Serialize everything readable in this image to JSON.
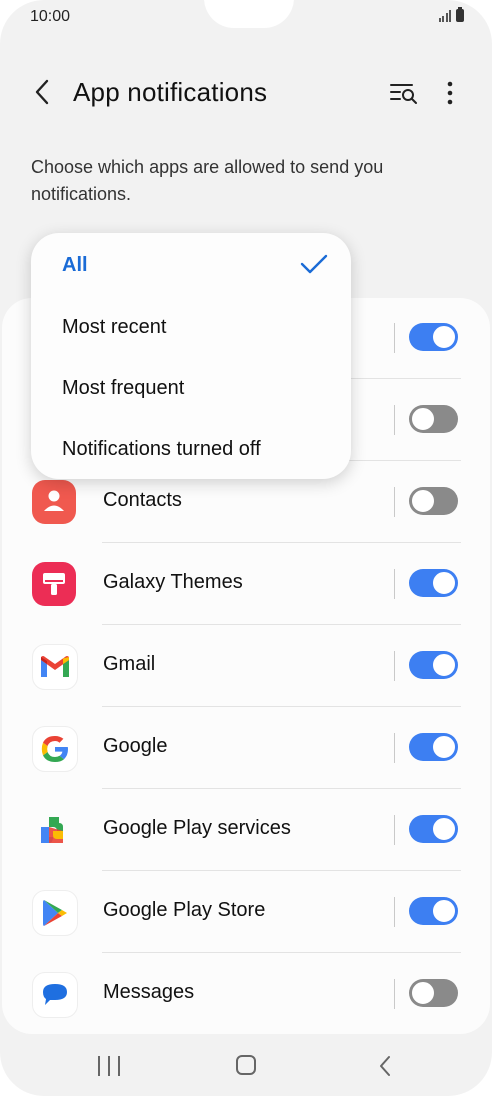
{
  "status_bar": {
    "time": "10:00"
  },
  "header": {
    "title": "App notifications"
  },
  "description": "Choose which apps are allowed to send you notifications.",
  "filter_menu": {
    "items": [
      {
        "label": "All",
        "selected": true
      },
      {
        "label": "Most recent",
        "selected": false
      },
      {
        "label": "Most frequent",
        "selected": false
      },
      {
        "label": "Notifications turned off",
        "selected": false
      }
    ]
  },
  "apps": [
    {
      "name": "",
      "enabled": true
    },
    {
      "name": "",
      "enabled": false
    },
    {
      "name": "Contacts",
      "enabled": false,
      "icon": "contacts-icon"
    },
    {
      "name": "Galaxy Themes",
      "enabled": true,
      "icon": "galaxy-themes-icon"
    },
    {
      "name": "Gmail",
      "enabled": true,
      "icon": "gmail-icon"
    },
    {
      "name": "Google",
      "enabled": true,
      "icon": "google-icon"
    },
    {
      "name": "Google Play services",
      "enabled": true,
      "icon": "google-play-services-icon"
    },
    {
      "name": "Google Play Store",
      "enabled": true,
      "icon": "google-play-store-icon"
    },
    {
      "name": "Messages",
      "enabled": false,
      "icon": "messages-icon"
    }
  ],
  "colors": {
    "accent": "#3d7ff2",
    "selected_text": "#1a6bd6",
    "toggle_off": "#8a8a8a"
  }
}
